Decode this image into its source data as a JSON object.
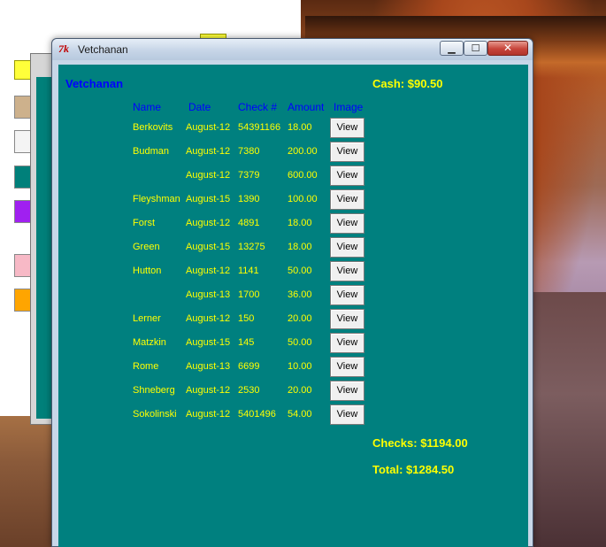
{
  "window": {
    "title": "Vetchanan",
    "icon_label": "7k",
    "controls": {
      "minimize": "▁",
      "maximize": "☐",
      "close": "✕"
    }
  },
  "header": {
    "name": "Vetchanan",
    "cash": "Cash: $90.50"
  },
  "columns": {
    "name": "Name",
    "date": "Date",
    "check": "Check #",
    "amount": "Amount",
    "image": "Image"
  },
  "view_label": "View",
  "rows": [
    {
      "name": "Berkovits",
      "date": "August-12",
      "check": "54391166",
      "amount": "18.00"
    },
    {
      "name": "Budman",
      "date": "August-12",
      "check": "7380",
      "amount": "200.00"
    },
    {
      "name": "",
      "date": "August-12",
      "check": "7379",
      "amount": "600.00"
    },
    {
      "name": "Fleyshman",
      "date": "August-15",
      "check": "1390",
      "amount": "100.00"
    },
    {
      "name": "Forst",
      "date": "August-12",
      "check": "4891",
      "amount": "18.00"
    },
    {
      "name": "Green",
      "date": "August-15",
      "check": "13275",
      "amount": "18.00"
    },
    {
      "name": "Hutton",
      "date": "August-12",
      "check": "1141",
      "amount": "50.00"
    },
    {
      "name": "",
      "date": "August-13",
      "check": "1700",
      "amount": "36.00"
    },
    {
      "name": "Lerner",
      "date": "August-12",
      "check": "150",
      "amount": "20.00"
    },
    {
      "name": "Matzkin",
      "date": "August-15",
      "check": "145",
      "amount": "50.00"
    },
    {
      "name": "Rome",
      "date": "August-13",
      "check": "6699",
      "amount": "10.00"
    },
    {
      "name": "Shneberg",
      "date": "August-12",
      "check": "2530",
      "amount": "20.00"
    },
    {
      "name": "Sokolinski",
      "date": "August-12",
      "check": "5401496",
      "amount": "54.00"
    }
  ],
  "totals": {
    "checks": "Checks: $1194.00",
    "total": "Total: $1284.50"
  },
  "colors": {
    "panel_background": "#00807f",
    "label_blue": "#0000ff",
    "value_yellow": "#ffff00"
  }
}
